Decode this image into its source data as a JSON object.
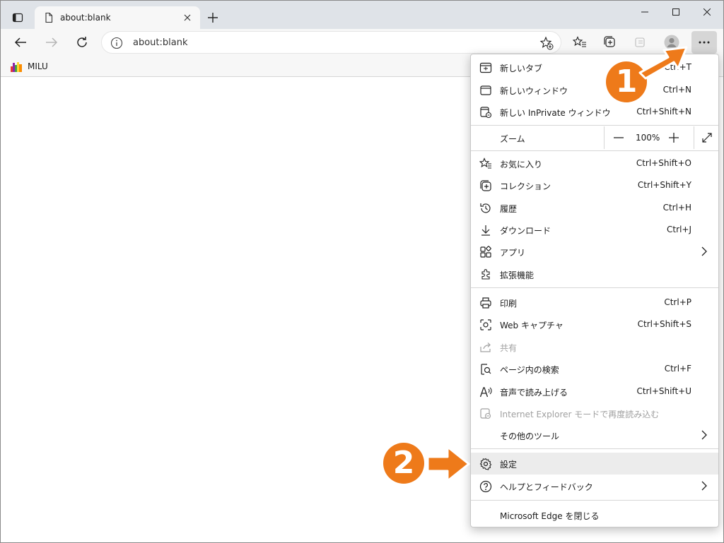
{
  "tab": {
    "title": "about:blank"
  },
  "address": {
    "url": "about:blank"
  },
  "favorites": [
    {
      "label": "MILU"
    }
  ],
  "menu": {
    "items_top": [
      {
        "label": "新しいタブ",
        "shortcut": "Ctrl+T",
        "icon": "new-tab-icon"
      },
      {
        "label": "新しいウィンドウ",
        "shortcut": "Ctrl+N",
        "icon": "new-window-icon"
      },
      {
        "label": "新しい InPrivate ウィンドウ",
        "shortcut": "Ctrl+Shift+N",
        "icon": "inprivate-icon"
      }
    ],
    "zoom": {
      "label": "ズーム",
      "value": "100%"
    },
    "items_mid": [
      {
        "label": "お気に入り",
        "shortcut": "Ctrl+Shift+O",
        "icon": "favorites-icon"
      },
      {
        "label": "コレクション",
        "shortcut": "Ctrl+Shift+Y",
        "icon": "collections-icon"
      },
      {
        "label": "履歴",
        "shortcut": "Ctrl+H",
        "icon": "history-icon"
      },
      {
        "label": "ダウンロード",
        "shortcut": "Ctrl+J",
        "icon": "download-icon"
      },
      {
        "label": "アプリ",
        "shortcut": "",
        "icon": "apps-icon"
      },
      {
        "label": "拡張機能",
        "shortcut": "",
        "icon": "extensions-icon"
      }
    ],
    "items_tools": [
      {
        "label": "印刷",
        "shortcut": "Ctrl+P",
        "icon": "print-icon"
      },
      {
        "label": "Web キャプチャ",
        "shortcut": "Ctrl+Shift+S",
        "icon": "web-capture-icon"
      },
      {
        "label": "共有",
        "shortcut": "",
        "icon": "share-icon"
      },
      {
        "label": "ページ内の検索",
        "shortcut": "Ctrl+F",
        "icon": "find-icon"
      },
      {
        "label": "音声で読み上げる",
        "shortcut": "Ctrl+Shift+U",
        "icon": "read-aloud-icon"
      },
      {
        "label": "Internet Explorer モードで再度読み込む",
        "shortcut": "",
        "icon": "ie-mode-icon"
      },
      {
        "label": "その他のツール",
        "shortcut": "",
        "icon": ""
      }
    ],
    "items_bottom": [
      {
        "label": "設定",
        "icon": "settings-icon"
      },
      {
        "label": "ヘルプとフィードバック",
        "icon": "help-icon"
      }
    ],
    "close_label": "Microsoft Edge を閉じる"
  },
  "annotations": {
    "step1": "1",
    "step2": "2",
    "accent": "#ee7a1a"
  }
}
